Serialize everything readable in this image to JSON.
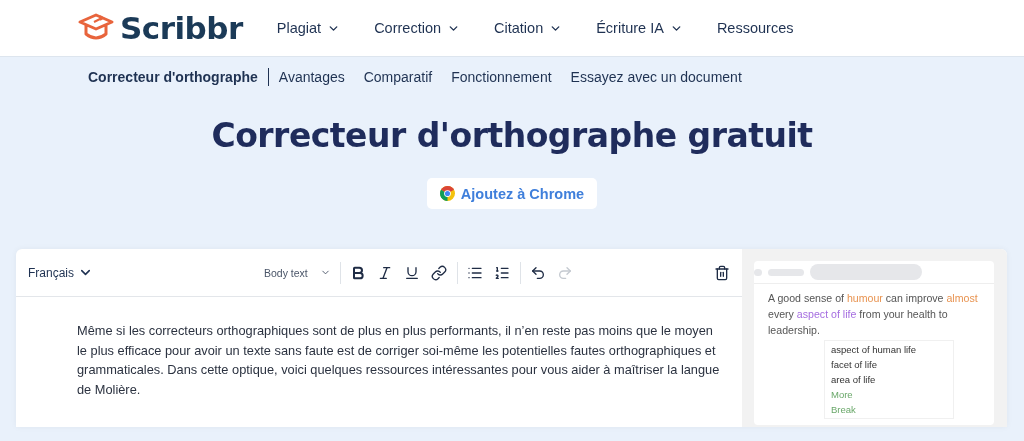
{
  "header": {
    "logo": "Scribbr",
    "nav": [
      {
        "label": "Plagiat",
        "dropdown": true
      },
      {
        "label": "Correction",
        "dropdown": true
      },
      {
        "label": "Citation",
        "dropdown": true
      },
      {
        "label": "Écriture IA",
        "dropdown": true
      },
      {
        "label": "Ressources",
        "dropdown": false
      }
    ]
  },
  "subnav": [
    {
      "label": "Correcteur d'orthographe",
      "selected": true
    },
    {
      "label": "Avantages",
      "selected": false
    },
    {
      "label": "Comparatif",
      "selected": false
    },
    {
      "label": "Fonctionnement",
      "selected": false
    },
    {
      "label": "Essayez avec un document",
      "selected": false
    }
  ],
  "title": "Correcteur d'orthographe gratuit",
  "chrome_button": "Ajoutez à Chrome",
  "editor": {
    "language": "Français",
    "style": "Body text",
    "tools": [
      {
        "kind": "bold",
        "disabled": false
      },
      {
        "kind": "italic",
        "disabled": false
      },
      {
        "kind": "underline",
        "disabled": false
      },
      {
        "kind": "link",
        "disabled": false
      },
      {
        "kind": "sep"
      },
      {
        "kind": "bullets",
        "disabled": false
      },
      {
        "kind": "numbers",
        "disabled": false
      },
      {
        "kind": "sep"
      },
      {
        "kind": "undo",
        "disabled": false
      },
      {
        "kind": "redo",
        "disabled": true
      }
    ],
    "text": "Même si les correcteurs orthographiques sont de plus en plus performants, il n’en reste pas moins que le moyen le plus efficace pour avoir un texte sans faute est de corriger soi-même les potentielles fautes orthographiques et grammaticales. Dans cette optique, voici quelques ressources intéressantes pour vous aider à maîtriser la langue de Molière."
  },
  "demo": {
    "segments": [
      {
        "text": "A good sense of ",
        "kind": "plain"
      },
      {
        "text": "humour",
        "kind": "spelling"
      },
      {
        "text": " can improve ",
        "kind": "plain"
      },
      {
        "text": "almost",
        "kind": "spelling"
      },
      {
        "text": " every ",
        "kind": "plain"
      },
      {
        "text": "aspect of life",
        "kind": "style"
      },
      {
        "text": " from your health to leadership.",
        "kind": "plain"
      }
    ],
    "menu": [
      {
        "label": "aspect of human life",
        "kind": "suggestion"
      },
      {
        "label": "facet of life",
        "kind": "suggestion"
      },
      {
        "label": "area of life",
        "kind": "suggestion"
      },
      {
        "label": "More",
        "kind": "action"
      },
      {
        "label": "Break",
        "kind": "action"
      }
    ]
  }
}
